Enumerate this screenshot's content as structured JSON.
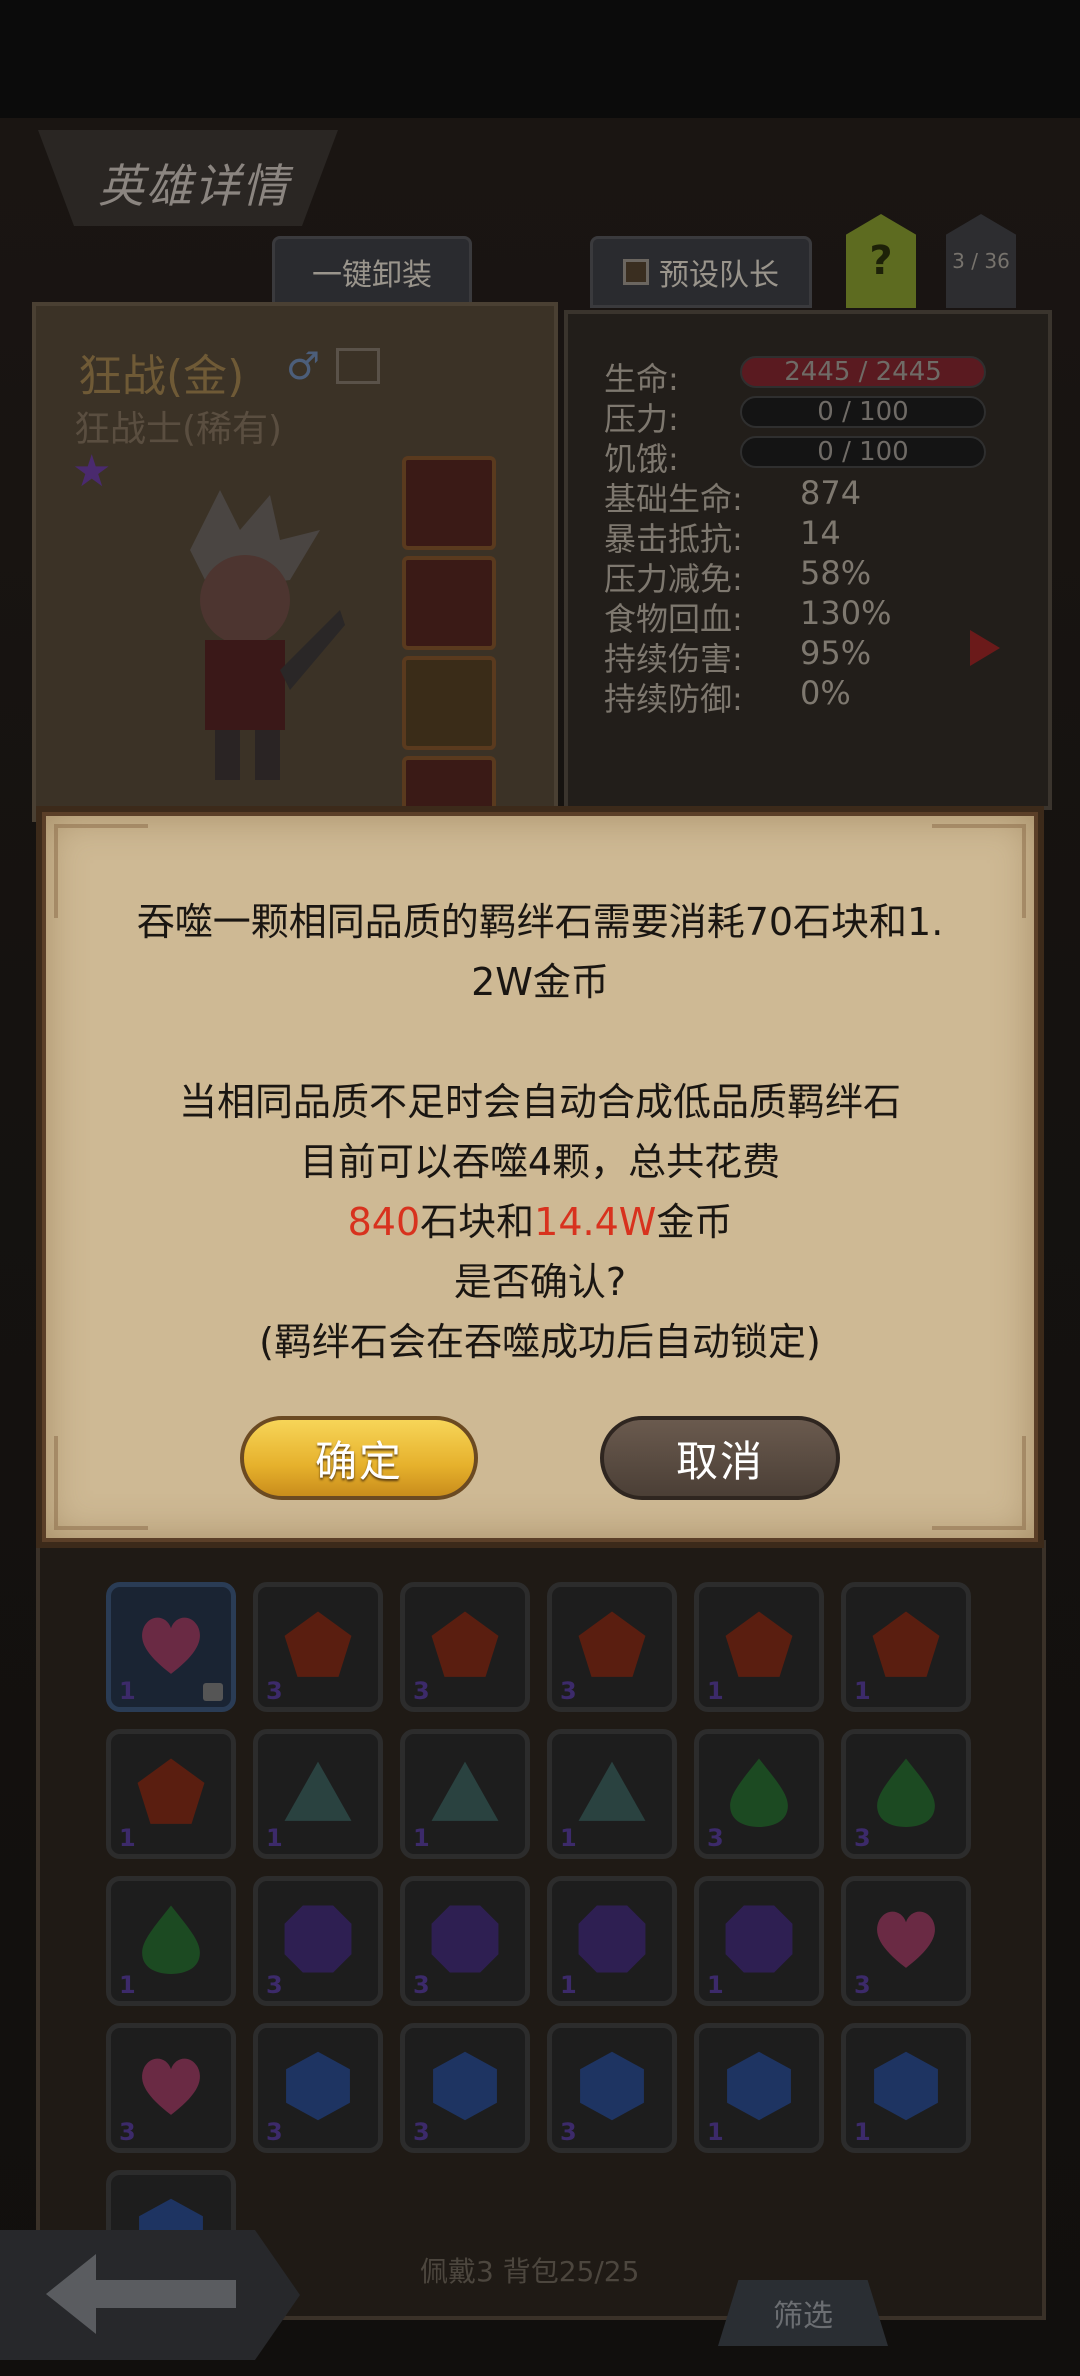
{
  "header": {
    "title": "英雄详情",
    "unequip_all_tab": "一键卸装",
    "preset_leader_tab": "预设队长",
    "help_tab": "?",
    "page_counter": "3 / 36"
  },
  "hero": {
    "name": "狂战(金)",
    "class": "狂战士(稀有)",
    "star": "★",
    "key_symbol": "♂"
  },
  "stats": {
    "life_label": "生命:",
    "life_value": "2445 / 2445",
    "pressure_label": "压力:",
    "pressure_value": "0 / 100",
    "hunger_label": "饥饿:",
    "hunger_value": "0 / 100",
    "rows": [
      {
        "label": "基础生命:",
        "value": "874"
      },
      {
        "label": "暴击抵抗:",
        "value": "14"
      },
      {
        "label": "压力减免:",
        "value": "58%"
      },
      {
        "label": "食物回血:",
        "value": "130%"
      },
      {
        "label": "持续伤害:",
        "value": "95%"
      },
      {
        "label": "持续防御:",
        "value": "0%"
      }
    ]
  },
  "dialog": {
    "line1": "吞噬一颗相同品质的羁绊石需要消耗70石块和1.",
    "line2": "2W金币",
    "line3": "当相同品质不足时会自动合成低品质羁绊石",
    "line4": "目前可以吞噬4颗，总共花费",
    "stone_cost": "840",
    "stone_text": "石块和",
    "gold_cost": "14.4W",
    "gold_text": "金币",
    "line6": "是否确认?",
    "line7": "(羁绊石会在吞噬成功后自动锁定)",
    "confirm_label": "确定",
    "cancel_label": "取消"
  },
  "bag": {
    "gems": [
      {
        "type": "heart",
        "count": "1",
        "locked": true
      },
      {
        "type": "pentagon",
        "count": "3"
      },
      {
        "type": "pentagon",
        "count": "3"
      },
      {
        "type": "pentagon",
        "count": "3"
      },
      {
        "type": "pentagon",
        "count": "1"
      },
      {
        "type": "pentagon",
        "count": "1"
      },
      {
        "type": "pentagon",
        "count": "1"
      },
      {
        "type": "triangle",
        "count": "1"
      },
      {
        "type": "triangle",
        "count": "1"
      },
      {
        "type": "triangle",
        "count": "1"
      },
      {
        "type": "drop",
        "count": "3"
      },
      {
        "type": "drop",
        "count": "3"
      },
      {
        "type": "drop",
        "count": "1"
      },
      {
        "type": "octagon",
        "count": "3"
      },
      {
        "type": "octagon",
        "count": "3"
      },
      {
        "type": "octagon",
        "count": "1"
      },
      {
        "type": "octagon",
        "count": "1"
      },
      {
        "type": "heart",
        "count": "3"
      },
      {
        "type": "heart",
        "count": "3"
      },
      {
        "type": "hexagon",
        "count": "3"
      },
      {
        "type": "hexagon",
        "count": "3"
      },
      {
        "type": "hexagon",
        "count": "3"
      },
      {
        "type": "hexagon",
        "count": "1"
      },
      {
        "type": "hexagon",
        "count": "1"
      }
    ],
    "footer": "佩戴3 背包25/25",
    "filter_label": "筛选"
  },
  "colors": {
    "heart": "#6a2a44",
    "pentagon": "#5a1e10",
    "triangle": "#2a4240",
    "drop": "#1c4a22",
    "octagon": "#2e1f52",
    "hexagon": "#1e3462",
    "confirm_button": "#f0c33c",
    "highlight": "#d8321e"
  }
}
